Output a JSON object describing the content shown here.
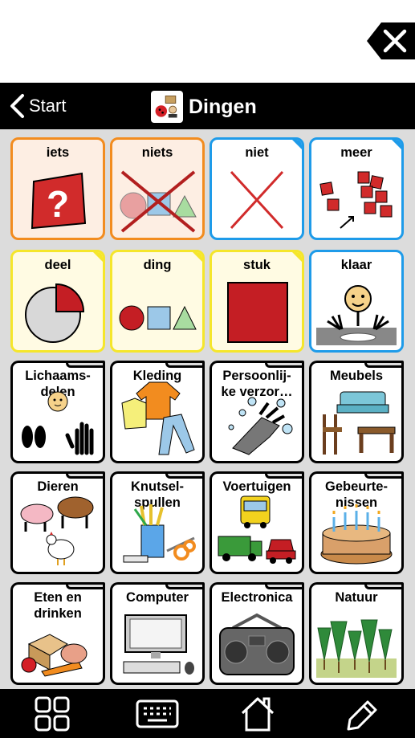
{
  "header": {
    "back_label": "Start",
    "title": "Dingen"
  },
  "grid": {
    "cells": [
      {
        "label": "iets",
        "style": "orange"
      },
      {
        "label": "niets",
        "style": "orange"
      },
      {
        "label": "niet",
        "style": "blue"
      },
      {
        "label": "meer",
        "style": "blue"
      },
      {
        "label": "deel",
        "style": "yellow"
      },
      {
        "label": "ding",
        "style": "yellow"
      },
      {
        "label": "stuk",
        "style": "yellow"
      },
      {
        "label": "klaar",
        "style": "blue"
      },
      {
        "label": "Lichaams-\ndelen",
        "style": "folder"
      },
      {
        "label": "Kleding",
        "style": "folder"
      },
      {
        "label": "Persoonlij-\nke verzor…",
        "style": "folder"
      },
      {
        "label": "Meubels",
        "style": "folder"
      },
      {
        "label": "Dieren",
        "style": "folder"
      },
      {
        "label": "Knutsel-\nspullen",
        "style": "folder"
      },
      {
        "label": "Voertuigen",
        "style": "folder"
      },
      {
        "label": "Gebeurte-\nnissen",
        "style": "folder"
      },
      {
        "label": "Eten en\ndrinken",
        "style": "folder"
      },
      {
        "label": "Computer",
        "style": "folder"
      },
      {
        "label": "Electronica",
        "style": "folder"
      },
      {
        "label": "Natuur",
        "style": "folder"
      }
    ]
  },
  "bottombar": {
    "icons": [
      "grid-icon",
      "keyboard-icon",
      "home-icon",
      "pencil-icon"
    ]
  },
  "colors": {
    "orange": "#f28c1f",
    "yellow": "#f5e62b",
    "blue": "#1e9be9",
    "header": "#000000",
    "grid_bg": "#dcdcdc"
  }
}
